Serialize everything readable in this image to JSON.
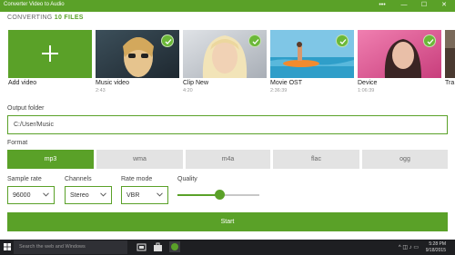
{
  "window": {
    "title": "Converter Video to Audio",
    "more_glyph": "•••",
    "minimize_glyph": "—",
    "maximize_glyph": "☐",
    "close_glyph": "✕"
  },
  "header": {
    "prefix": "CONVERTING",
    "count": "10 FILES"
  },
  "tiles": [
    {
      "label": "Add video",
      "duration": ""
    },
    {
      "label": "Music video",
      "duration": "2:43"
    },
    {
      "label": "Clip New",
      "duration": "4:20"
    },
    {
      "label": "Movie OST",
      "duration": "2:36:39"
    },
    {
      "label": "Device",
      "duration": "1:06:39"
    },
    {
      "label": "Tra",
      "duration": ""
    }
  ],
  "output": {
    "label": "Output folder",
    "value": "C:/User/Music"
  },
  "format": {
    "label": "Format",
    "options": [
      "mp3",
      "wma",
      "m4a",
      "flac",
      "ogg"
    ],
    "selected": "mp3"
  },
  "settings": {
    "sample_rate": {
      "label": "Sample rate",
      "value": "96000"
    },
    "channels": {
      "label": "Channels",
      "value": "Stereo"
    },
    "rate_mode": {
      "label": "Rate mode",
      "value": "VBR"
    },
    "quality": {
      "label": "Quality",
      "level": 0.52
    }
  },
  "start_label": "Start",
  "taskbar": {
    "search_placeholder": "Search the web and Windows",
    "time": "5:28 PM",
    "date": "9/18/2015"
  },
  "colors": {
    "accent": "#5aa128",
    "taskbar": "#1e1f22"
  }
}
